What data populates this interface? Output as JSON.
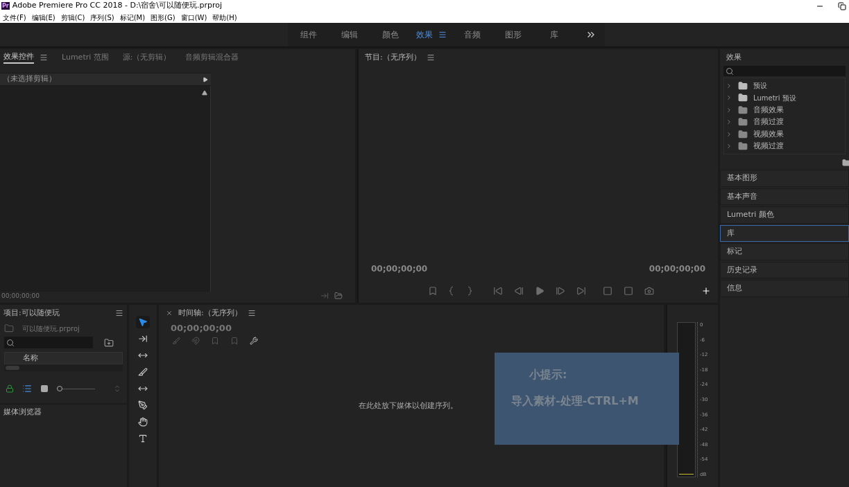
{
  "window": {
    "app_icon": "Pr",
    "title": "Adobe Premiere Pro CC 2018 - D:\\宿舍\\可以随便玩.prproj"
  },
  "menu": [
    "文件(F)",
    "编辑(E)",
    "剪辑(C)",
    "序列(S)",
    "标记(M)",
    "图形(G)",
    "窗口(W)",
    "帮助(H)"
  ],
  "workspaces": [
    {
      "label": "组件",
      "selected": false
    },
    {
      "label": "编辑",
      "selected": false
    },
    {
      "label": "颜色",
      "selected": false
    },
    {
      "label": "效果",
      "selected": true
    },
    {
      "label": "音频",
      "selected": false
    },
    {
      "label": "图形",
      "selected": false
    },
    {
      "label": "库",
      "selected": false
    }
  ],
  "effect_controls": {
    "tabs": [
      {
        "label": "效果控件",
        "selected": true
      },
      {
        "label": "Lumetri 范围",
        "selected": false
      },
      {
        "label": "源:（无剪辑）",
        "selected": false
      },
      {
        "label": "音频剪辑混合器",
        "selected": false
      }
    ],
    "clip": "（未选择剪辑）",
    "timecode": "00;00;00;00"
  },
  "program": {
    "title": "节目:（无序列）",
    "timecode_left": "00;00;00;00",
    "timecode_right": "00;00;00;00"
  },
  "effects": {
    "title": "效果",
    "folders": [
      {
        "label": "预设",
        "kind": "preset"
      },
      {
        "label": "Lumetri 预设",
        "kind": "preset"
      },
      {
        "label": "音频效果",
        "kind": "folder"
      },
      {
        "label": "音频过渡",
        "kind": "folder"
      },
      {
        "label": "视频效果",
        "kind": "folder"
      },
      {
        "label": "视频过渡",
        "kind": "folder"
      }
    ],
    "panels": [
      {
        "label": "基本图形",
        "selected": false
      },
      {
        "label": "基本声音",
        "selected": false
      },
      {
        "label": "Lumetri 颜色",
        "selected": false
      },
      {
        "label": "库",
        "selected": true
      },
      {
        "label": "标记",
        "selected": false
      },
      {
        "label": "历史记录",
        "selected": false
      },
      {
        "label": "信息",
        "selected": false
      }
    ]
  },
  "project": {
    "title": "项目:可以随便玩",
    "file": "可以随便玩.prproj",
    "column": "名称",
    "section": "媒体浏览器",
    "zoom": {
      "level": 0
    }
  },
  "tools": [
    {
      "kind": "select",
      "selected": true
    },
    {
      "kind": "track",
      "selected": false
    },
    {
      "kind": "ripple",
      "selected": false
    },
    {
      "kind": "razor",
      "selected": false
    },
    {
      "kind": "slip",
      "selected": false
    },
    {
      "kind": "pen",
      "selected": false
    },
    {
      "kind": "hand",
      "selected": false
    },
    {
      "kind": "type",
      "selected": false
    }
  ],
  "timeline": {
    "title": "时间轴:（无序列）",
    "timecode": "00;00;00;00",
    "empty_message": "在此处放下媒体以创建序列。"
  },
  "meter": {
    "scale": [
      "0",
      "-6",
      "-12",
      "-18",
      "-24",
      "-30",
      "-36",
      "-42",
      "-48",
      "-54",
      "dB"
    ]
  },
  "tip": {
    "title": "小提示:",
    "text": "导入素材-处理-CTRL+M"
  }
}
